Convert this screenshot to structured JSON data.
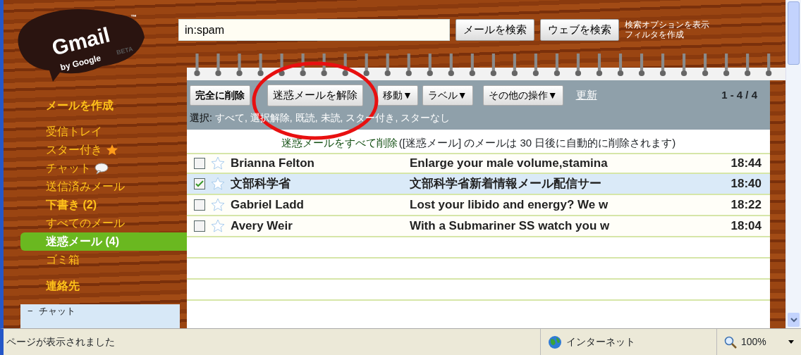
{
  "logo": {
    "word": "Gmail",
    "tm": "™",
    "by": "by Google",
    "beta": "BETA"
  },
  "search": {
    "value": "in:spam",
    "buttons": [
      "メールを検索",
      "ウェブを検索"
    ],
    "links": [
      "検索オプションを表示",
      "フィルタを作成"
    ]
  },
  "sidebar": {
    "compose": "メールを作成",
    "items": [
      {
        "label": "受信トレイ",
        "kind": "plain",
        "bold": false,
        "selected": false
      },
      {
        "label": "スター付き",
        "kind": "starred",
        "bold": false,
        "selected": false
      },
      {
        "label": "チャット",
        "kind": "chat",
        "bold": false,
        "selected": false
      },
      {
        "label": "送信済みメール",
        "kind": "plain",
        "bold": false,
        "selected": false
      },
      {
        "label": "下書き (2)",
        "kind": "plain",
        "bold": true,
        "selected": false
      },
      {
        "label": "すべてのメール",
        "kind": "plain",
        "bold": false,
        "selected": false
      },
      {
        "label": "迷惑メール (4)",
        "kind": "plain",
        "bold": true,
        "selected": true
      },
      {
        "label": "ゴミ箱",
        "kind": "plain",
        "bold": false,
        "selected": false
      }
    ],
    "contacts": "連絡先",
    "chat_panel": {
      "toggle": "−",
      "title": "チャット"
    }
  },
  "toolbar": {
    "buttons": [
      {
        "label": "完全に削除",
        "bold": true
      },
      {
        "label": "迷惑メールを解除",
        "bold": false
      },
      {
        "label": "移動▼",
        "bold": false
      },
      {
        "label": "ラベル▼",
        "bold": false
      },
      {
        "label": "その他の操作▼",
        "bold": false
      }
    ],
    "refresh": "更新",
    "count": "1 - 4 / 4",
    "select_label": "選択:",
    "select_links": [
      "すべて,",
      "選択解除,",
      "既読,",
      "未読,",
      "スター付き,",
      "スターなし"
    ]
  },
  "notice": {
    "link": "迷惑メールをすべて削除",
    "text": "([迷惑メール] のメールは 30 日後に自動的に削除されます)"
  },
  "rows": [
    {
      "sender": "Brianna Felton",
      "subject": "Enlarge your male volume,stamina",
      "time": "18:44",
      "checked": false,
      "starred": false
    },
    {
      "sender": "文部科学省",
      "subject": "文部科学省新着情報メール配信サー",
      "time": "18:40",
      "checked": true,
      "starred": false
    },
    {
      "sender": "Gabriel Ladd",
      "subject": "Lost your libido and energy? We w",
      "time": "18:22",
      "checked": false,
      "starred": false
    },
    {
      "sender": "Avery Weir",
      "subject": "With a Submariner SS watch you w",
      "time": "18:04",
      "checked": false,
      "starred": false
    }
  ],
  "annotation": {
    "kind": "circle"
  },
  "status_bar": {
    "message": "ページが表示されました",
    "zone": "インターネット",
    "zoom": "100%"
  }
}
